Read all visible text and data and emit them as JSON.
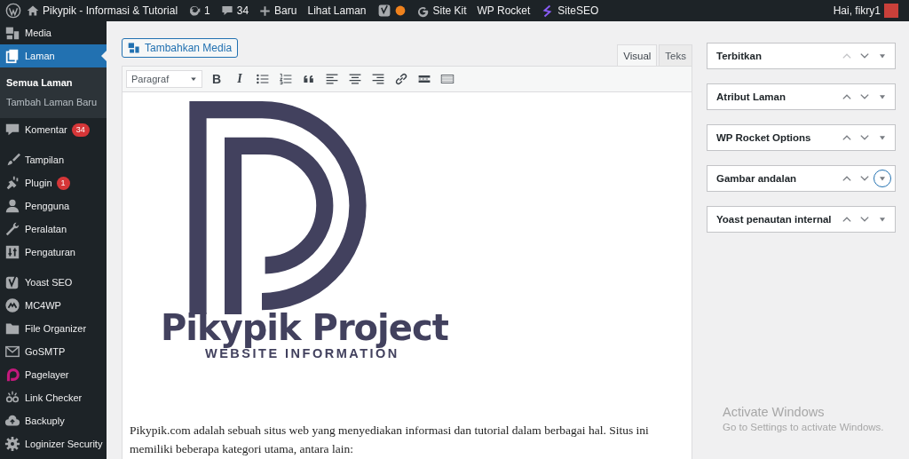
{
  "admin_bar": {
    "site_title": "Pikypik - Informasi & Tutorial",
    "updates": "1",
    "comments": "34",
    "new_label": "Baru",
    "links": [
      {
        "kind": "plain",
        "label": "Lihat Laman"
      },
      {
        "kind": "seo"
      },
      {
        "kind": "g",
        "label": "Site Kit"
      },
      {
        "kind": "plain",
        "label": "WP Rocket"
      },
      {
        "kind": "s",
        "label": "SiteSEO"
      }
    ],
    "greeting": "Hai, fikry1"
  },
  "sidebar": {
    "items": [
      {
        "label": "Media",
        "selected": false
      },
      {
        "label": "Laman",
        "selected": true,
        "children": [
          {
            "label": "Semua Laman",
            "selected": true
          },
          {
            "label": "Tambah Laman Baru",
            "selected": false
          }
        ]
      },
      {
        "label": "Komentar",
        "selected": false,
        "badge": "34"
      },
      {
        "label": "Tampilan",
        "selected": false,
        "group_start": true
      },
      {
        "label": "Plugin",
        "selected": false,
        "badge": "1"
      },
      {
        "label": "Pengguna",
        "selected": false
      },
      {
        "label": "Peralatan",
        "selected": false
      },
      {
        "label": "Pengaturan",
        "selected": false
      },
      {
        "label": "Yoast SEO",
        "selected": false,
        "group_start": true
      },
      {
        "label": "MC4WP",
        "selected": false
      },
      {
        "label": "File Organizer",
        "selected": false
      },
      {
        "label": "GoSMTP",
        "selected": false
      },
      {
        "label": "Pagelayer",
        "selected": false
      },
      {
        "label": "Link Checker",
        "selected": false
      },
      {
        "label": "Backuply",
        "selected": false
      },
      {
        "label": "Loginizer Security",
        "selected": false
      }
    ]
  },
  "editor": {
    "media_button": "Tambahkan Media",
    "tabs": [
      {
        "label": "Visual",
        "selected": true
      },
      {
        "label": "Teks",
        "selected": false
      }
    ],
    "format_select": "Paragraf",
    "bold": "B",
    "italic": "I",
    "logo_title": "Pikypik Project",
    "logo_subtitle": "WEBSITE INFORMATION",
    "paragraph": "Pikypik.com adalah sebuah situs web yang menyediakan informasi dan tutorial dalam berbagai hal. Situs ini memiliki beberapa kategori utama, antara lain:"
  },
  "metaboxes": [
    {
      "title": "Terbitkan",
      "up_disabled": true,
      "focused": false
    },
    {
      "title": "Atribut Laman",
      "up_disabled": false,
      "focused": false
    },
    {
      "title": "WP Rocket Options",
      "up_disabled": false,
      "focused": false
    },
    {
      "title": "Gambar andalan",
      "up_disabled": false,
      "focused": true
    },
    {
      "title": "Yoast penautan internal",
      "up_disabled": false,
      "focused": false
    }
  ],
  "os_notice": {
    "title": "Activate Windows",
    "subtitle": "Go to Settings to activate Windows."
  }
}
